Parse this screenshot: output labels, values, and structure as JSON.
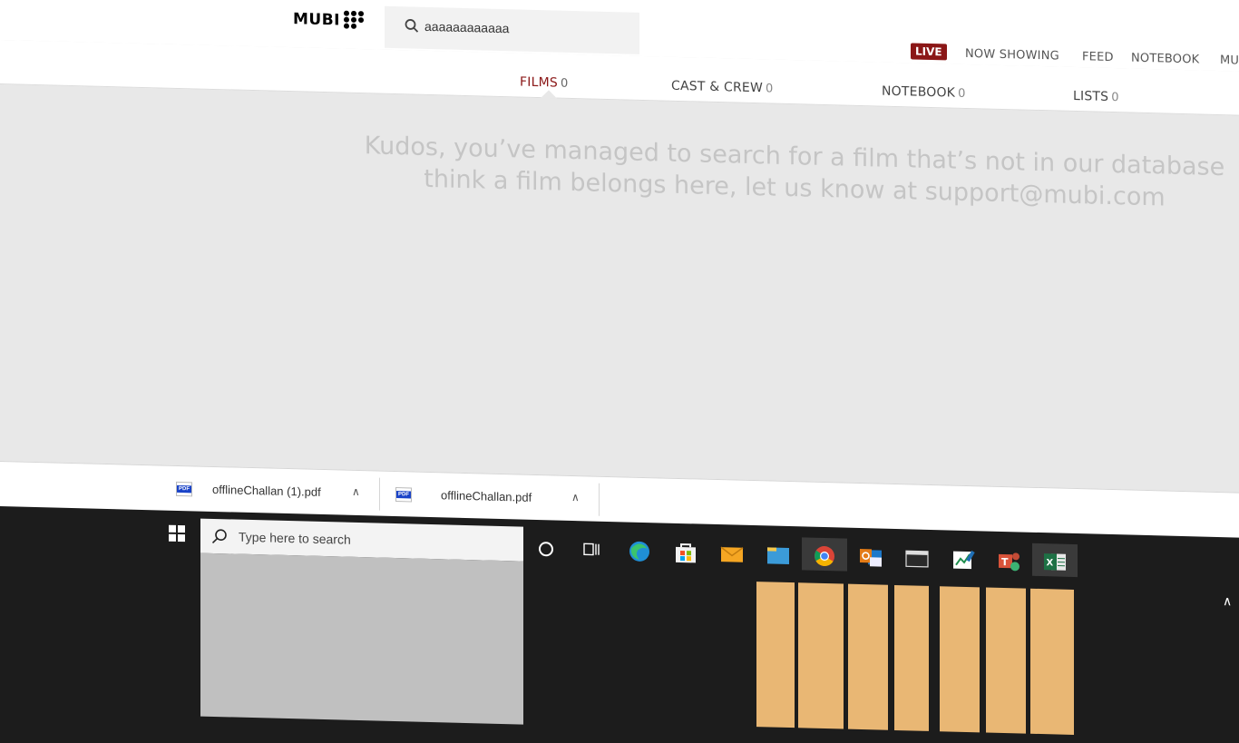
{
  "header": {
    "logo": "MUBI",
    "search_value": "aaaaaaaaaaaa",
    "live_badge": "LIVE",
    "nav": [
      "NOW SHOWING",
      "FEED",
      "NOTEBOOK",
      "MU"
    ]
  },
  "tabs": [
    {
      "label": "FILMS",
      "count": "0",
      "active": true
    },
    {
      "label": "CAST & CREW",
      "count": "0",
      "active": false
    },
    {
      "label": "NOTEBOOK",
      "count": "0",
      "active": false
    },
    {
      "label": "LISTS",
      "count": "0",
      "active": false
    }
  ],
  "empty_message": {
    "line1": "Kudos, you’ve managed to search for a film that’s not in our database",
    "line2": "think a film belongs here, let us know at support@mubi.com"
  },
  "downloads": [
    {
      "name": "offlineChallan (1).pdf",
      "icon": "pdf-icon"
    },
    {
      "name": "offlineChallan.pdf",
      "icon": "pdf-icon"
    }
  ],
  "taskbar": {
    "search_placeholder": "Type here to search",
    "apps": [
      "edge-icon",
      "store-icon",
      "mail-icon",
      "file-explorer-icon",
      "chrome-icon",
      "outlook-icon",
      "terminal-icon",
      "whiteboard-icon",
      "teams-icon",
      "excel-icon"
    ]
  },
  "colors": {
    "accent": "#8b1717",
    "page_bg": "#e8e8e8",
    "taskbar_bg": "#1c1c1c",
    "stripe": "#e9b774"
  }
}
